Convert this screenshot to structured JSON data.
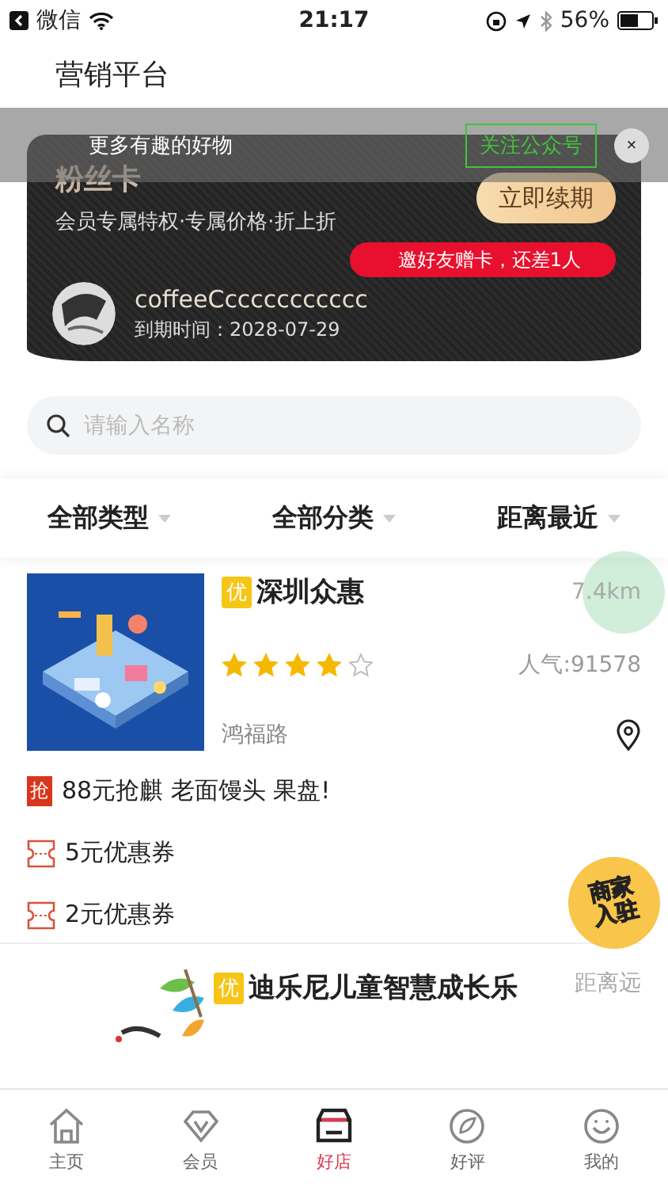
{
  "status_bar": {
    "back_app": "微信",
    "time": "21:17",
    "battery": "56%"
  },
  "header": {
    "title": "营销平台"
  },
  "follow_banner": {
    "text": "更多有趣的好物",
    "button": "关注公众号",
    "close": "×"
  },
  "fan_card": {
    "title": "粉丝卡",
    "subtitle": "会员专属特权·专属价格·折上折",
    "renew_button": "立即续期",
    "invite_tip": "邀好友赠卡，还差1人",
    "username": "coffeeCccccccccccc",
    "expiry": "到期时间：2028-07-29"
  },
  "search": {
    "placeholder": "请输入名称"
  },
  "filters": [
    {
      "label": "全部类型"
    },
    {
      "label": "全部分类"
    },
    {
      "label": "距离最近"
    }
  ],
  "stores": [
    {
      "badge": "优",
      "name": "深圳众惠",
      "distance": "7.4km",
      "stars": 4,
      "popularity": "人气:91578",
      "address": "鸿福路",
      "promos": [
        {
          "kind": "deal",
          "icon": "抢",
          "text": "88元抢麒 老面馒头 果盘!"
        },
        {
          "kind": "coupon",
          "text": "5元优惠券"
        },
        {
          "kind": "coupon",
          "text": "2元优惠券"
        }
      ]
    },
    {
      "badge": "优",
      "name": "迪乐尼儿童智慧成长乐",
      "distance": "距离远"
    }
  ],
  "merchant_badge": {
    "line1": "商家",
    "line2": "入驻"
  },
  "tab_bar": [
    {
      "label": "主页",
      "selected": false
    },
    {
      "label": "会员",
      "selected": false
    },
    {
      "label": "好店",
      "selected": true
    },
    {
      "label": "好评",
      "selected": false
    },
    {
      "label": "我的",
      "selected": false
    }
  ]
}
